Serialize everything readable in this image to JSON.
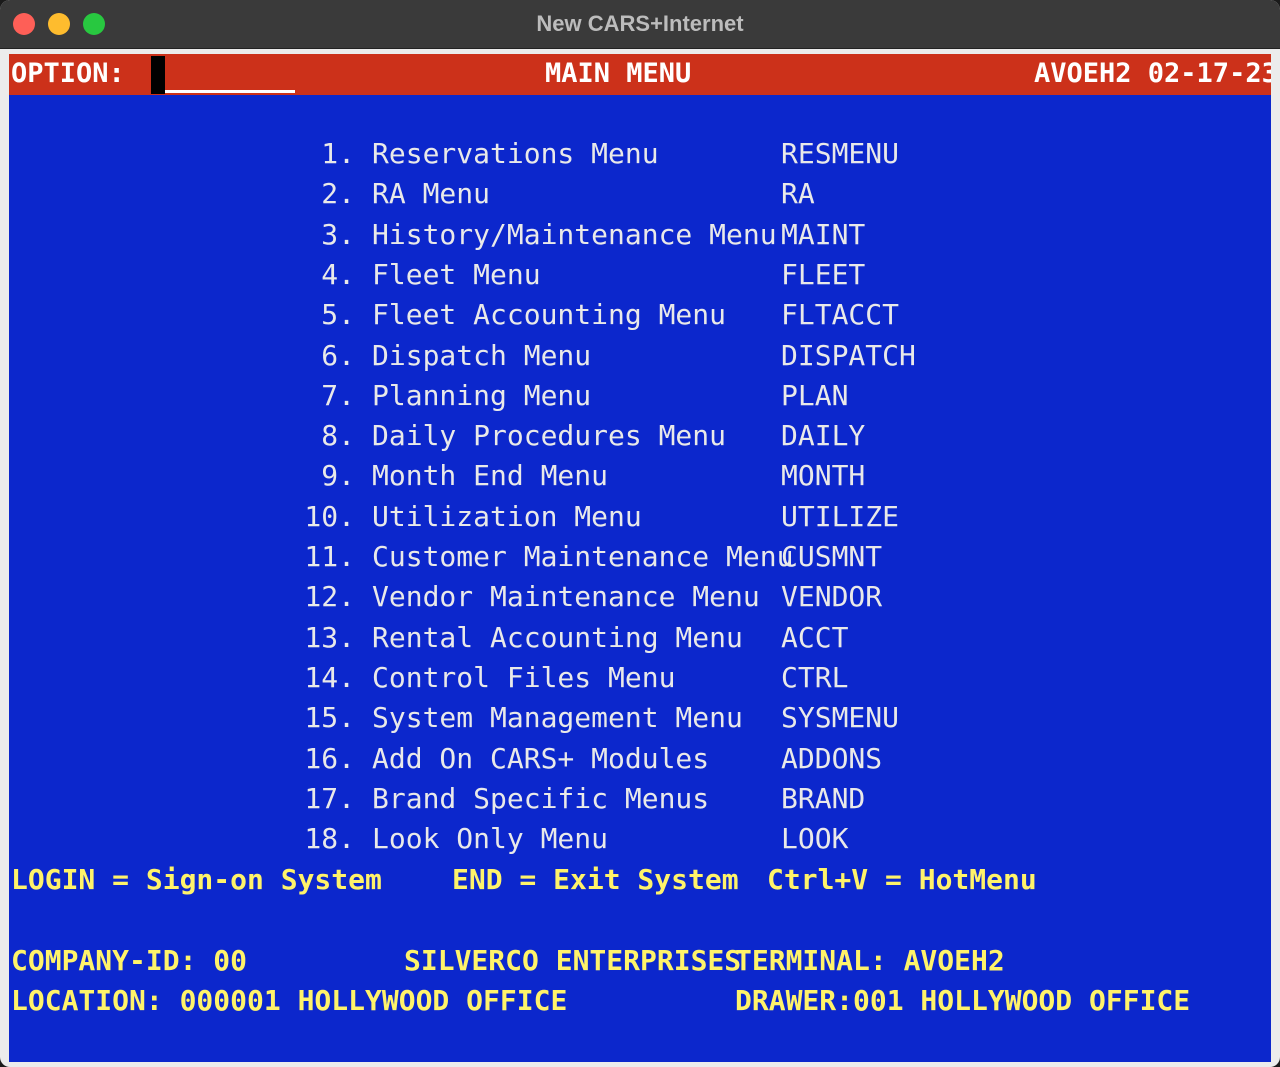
{
  "window": {
    "title": "New CARS+Internet"
  },
  "header": {
    "option_label": "OPTION:",
    "option_value": "",
    "title": "MAIN MENU",
    "terminal_date": "AVOEH2 02-17-23"
  },
  "menu": [
    {
      "num": "1.",
      "label": "Reservations Menu",
      "code": "RESMENU"
    },
    {
      "num": "2.",
      "label": "RA Menu",
      "code": "RA"
    },
    {
      "num": "3.",
      "label": "History/Maintenance Menu",
      "code": "MAINT"
    },
    {
      "num": "4.",
      "label": "Fleet Menu",
      "code": "FLEET"
    },
    {
      "num": "5.",
      "label": "Fleet Accounting Menu",
      "code": "FLTACCT"
    },
    {
      "num": "6.",
      "label": "Dispatch Menu",
      "code": "DISPATCH"
    },
    {
      "num": "7.",
      "label": "Planning Menu",
      "code": "PLAN"
    },
    {
      "num": "8.",
      "label": "Daily Procedures Menu",
      "code": "DAILY"
    },
    {
      "num": "9.",
      "label": "Month End Menu",
      "code": "MONTH"
    },
    {
      "num": "10.",
      "label": "Utilization Menu",
      "code": "UTILIZE"
    },
    {
      "num": "11.",
      "label": "Customer Maintenance Menu",
      "code": "CUSMNT"
    },
    {
      "num": "12.",
      "label": "Vendor Maintenance Menu",
      "code": "VENDOR"
    },
    {
      "num": "13.",
      "label": "Rental Accounting Menu",
      "code": "ACCT"
    },
    {
      "num": "14.",
      "label": "Control Files Menu",
      "code": "CTRL"
    },
    {
      "num": "15.",
      "label": "System Management Menu",
      "code": "SYSMENU"
    },
    {
      "num": "16.",
      "label": "Add On CARS+ Modules",
      "code": "ADDONS"
    },
    {
      "num": "17.",
      "label": "Brand Specific Menus",
      "code": "BRAND"
    },
    {
      "num": "18.",
      "label": "Look Only Menu",
      "code": "LOOK"
    }
  ],
  "hotkeys": {
    "login": "LOGIN = Sign-on System",
    "end": "END = Exit System",
    "hotmenu": "Ctrl+V = HotMenu"
  },
  "footer": {
    "company_id": "COMPANY-ID: 00",
    "company_name": "SILVERCO ENTERPRISES",
    "terminal": "TERMINAL: AVOEH2",
    "location": "LOCATION: 000001 HOLLYWOOD OFFICE",
    "drawer": "DRAWER:001 HOLLYWOOD OFFICE"
  },
  "colors": {
    "terminal_bg": "#0c27cc",
    "header_bg": "#cc311a",
    "menu_text": "#e9e9e9",
    "highlight_text": "#fff36a"
  }
}
